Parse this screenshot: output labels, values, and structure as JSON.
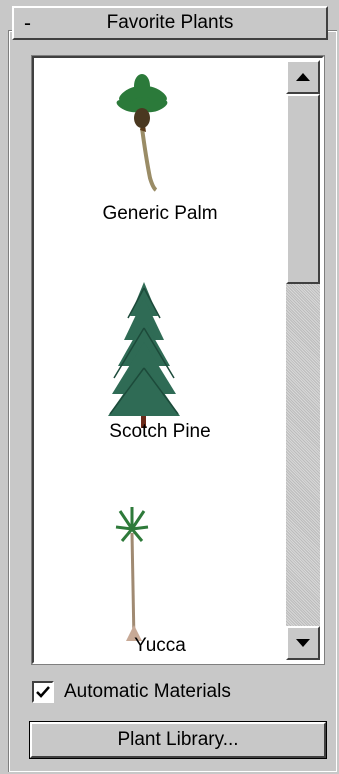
{
  "rollout": {
    "collapse_symbol": "-",
    "title": "Favorite Plants"
  },
  "plants": [
    {
      "name": "Generic Palm",
      "icon": "palm-tree-icon"
    },
    {
      "name": "Scotch Pine",
      "icon": "pine-tree-icon"
    },
    {
      "name": "Yucca",
      "icon": "yucca-plant-icon"
    }
  ],
  "options": {
    "automatic_materials_label": "Automatic Materials",
    "automatic_materials_checked": true
  },
  "buttons": {
    "plant_library_label": "Plant Library..."
  },
  "colors": {
    "panel_bg": "#c8c8c8",
    "list_bg": "#ffffff",
    "foliage": "#1f6b35"
  }
}
